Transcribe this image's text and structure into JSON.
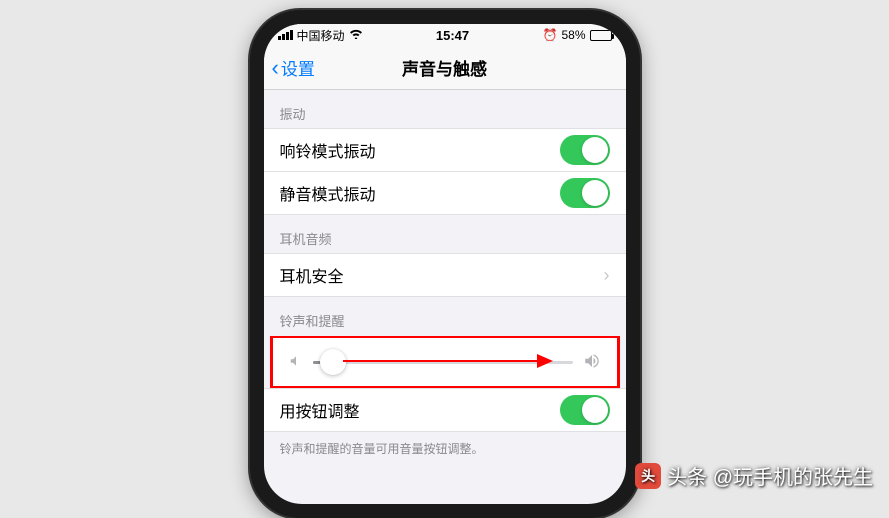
{
  "status_bar": {
    "carrier": "中国移动",
    "time": "15:47",
    "battery_percent": "58%",
    "alarm": "⏰"
  },
  "nav": {
    "back_label": "设置",
    "title": "声音与触感"
  },
  "sections": {
    "vibration": {
      "header": "振动",
      "ring_vibrate": "响铃模式振动",
      "silent_vibrate": "静音模式振动"
    },
    "headphone": {
      "header": "耳机音频",
      "safety": "耳机安全"
    },
    "ringer": {
      "header": "铃声和提醒",
      "change_with_buttons": "用按钮调整",
      "note": "铃声和提醒的音量可用音量按钮调整。"
    }
  },
  "watermark": {
    "badge": "头",
    "text": "头条 @玩手机的张先生"
  }
}
